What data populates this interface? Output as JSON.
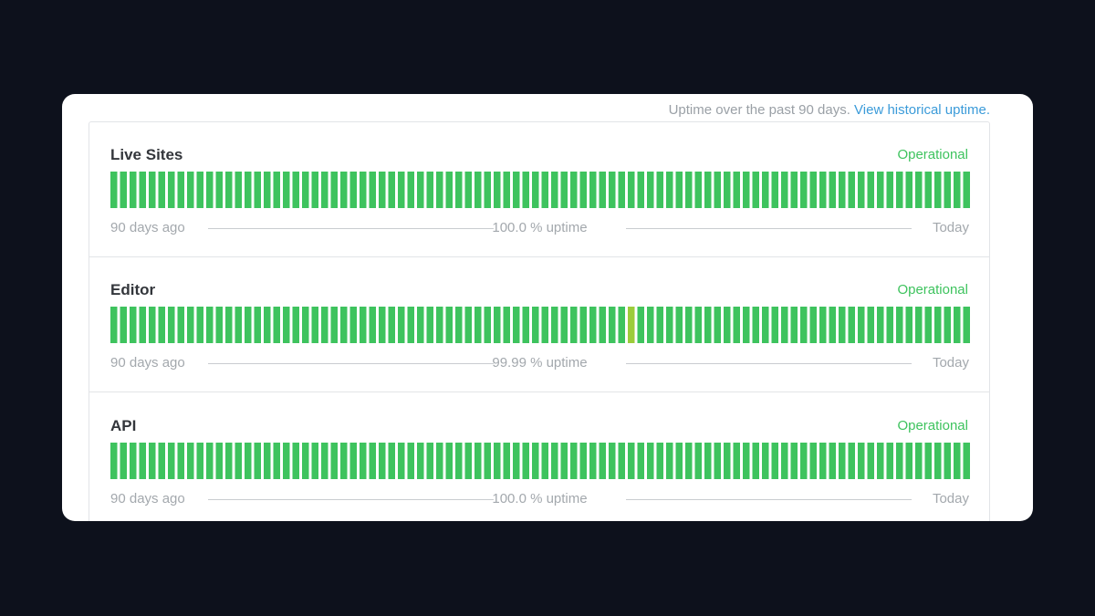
{
  "header": {
    "text": "Uptime over the past 90 days.",
    "link_label": "View historical uptime."
  },
  "colors": {
    "operational": "#3ec35e",
    "degraded": "#9ccc3a",
    "background": "#0d111c",
    "card": "#ffffff"
  },
  "components": [
    {
      "name": "Live Sites",
      "status": "Operational",
      "days": 90,
      "degraded_days": [],
      "left_label": "90 days ago",
      "uptime_label": "100.0 % uptime",
      "right_label": "Today"
    },
    {
      "name": "Editor",
      "status": "Operational",
      "days": 90,
      "degraded_days": [
        54
      ],
      "left_label": "90 days ago",
      "uptime_label": "99.99 % uptime",
      "right_label": "Today"
    },
    {
      "name": "API",
      "status": "Operational",
      "days": 90,
      "degraded_days": [],
      "left_label": "90 days ago",
      "uptime_label": "100.0 % uptime",
      "right_label": "Today"
    }
  ]
}
